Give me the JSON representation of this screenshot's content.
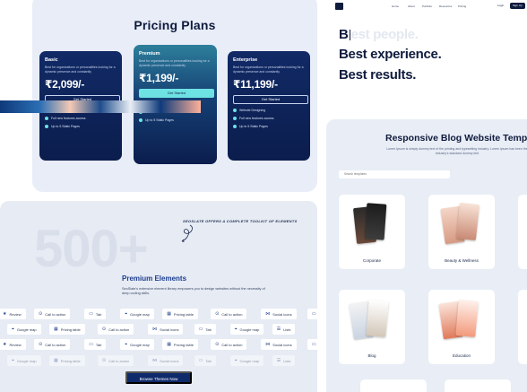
{
  "pricing": {
    "title": "Pricing Plans",
    "plans": [
      {
        "name": "Basic",
        "desc": "Best for organizations or personalities looking for a dynamic presence and constantly",
        "price": "₹2,099/-",
        "cta": "Get Started",
        "features": [
          "Website Designing",
          "Full new features access",
          "Up to 5 Static Pages"
        ]
      },
      {
        "name": "Premium",
        "desc": "Best for organizations or personalities looking for a dynamic presence and constantly",
        "price": "₹1,199/-",
        "cta": "Get Started",
        "features": [
          "Website Designing",
          "Full new features access",
          "Up to 5 Static Pages"
        ]
      },
      {
        "name": "Enterprise",
        "desc": "Best for organizations or personalities looking for a dynamic presence and constantly",
        "price": "₹11,199/-",
        "cta": "Get Started",
        "features": [
          "Website Designing",
          "Full new features access",
          "Up to 5 Static Pages"
        ]
      }
    ]
  },
  "elements": {
    "big_number": "500+",
    "hand_note": "SEOSLATE OFFERS A COMPLETE TOOLKIT OF ELEMENTS",
    "title": "Premium Elements",
    "desc": "SeoSlate's extensive element library empowers you to design websites without the necessity of deep coding skills.",
    "pill_rows": [
      [
        "Review",
        "Call to action",
        "Tab",
        "Google map",
        "Pricing table",
        "Call to action",
        "Social icons",
        "Tab"
      ],
      [
        "Google map",
        "Pricing table",
        "Call to action",
        "Social icons",
        "Tab",
        "Google map",
        "Lists"
      ],
      [
        "Review",
        "Call to action",
        "Tab",
        "Google map",
        "Pricing table",
        "Call to action",
        "Social icons",
        "Tab"
      ],
      [
        "Google map",
        "Pricing table",
        "Call to action",
        "Social icons",
        "Tab",
        "Google map",
        "Lists"
      ]
    ],
    "browse_button": "Browse Themes Now"
  },
  "hero": {
    "nav_links": [
      "Home",
      "About",
      "Portfolio",
      "Resources",
      "Pricing"
    ],
    "login": "Login",
    "signup": "Sign Up",
    "line1_typed": "B",
    "line1_faded": "est people.",
    "line2": "Best experience.",
    "line3": "Best results."
  },
  "blog": {
    "title": "Responsive Blog Website Templat",
    "subtitle": "Lorem Ipsum is simply dummy text of the printing and typesetting industry. Lorem Ipsum has been the industry's standard dummy text",
    "search_placeholder": "Search templates",
    "templates": [
      {
        "label": "Corporate"
      },
      {
        "label": "Beauty & Wellness"
      },
      {
        "label": "Blog"
      },
      {
        "label": "Education"
      }
    ]
  },
  "colors": {
    "navy": "#0f1b3d",
    "card_dark": "#0b1d4d",
    "teal_accent": "#6ee2e3",
    "panel_bg": "#e8edf7",
    "brand_blue": "#1d3e8f"
  }
}
